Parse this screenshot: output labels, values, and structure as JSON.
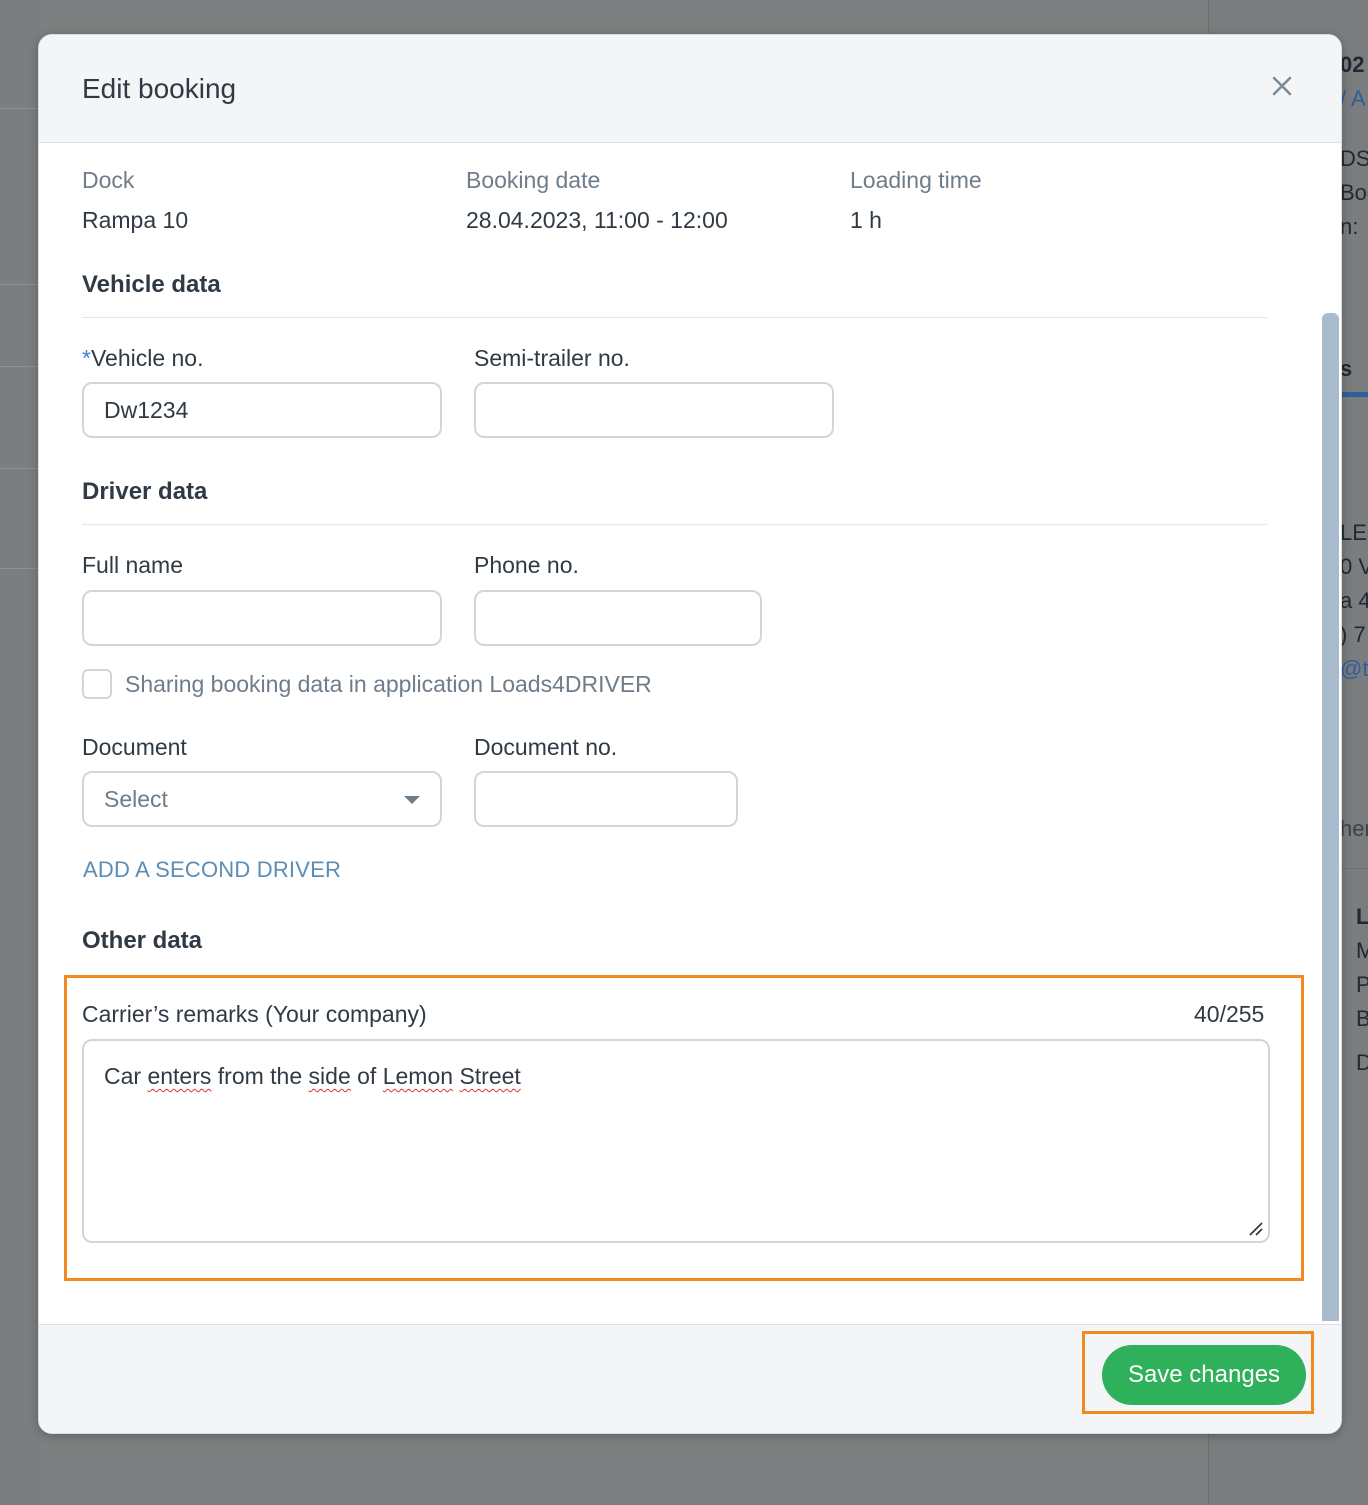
{
  "modal": {
    "title": "Edit booking",
    "close_icon": "close-icon"
  },
  "summary": {
    "dock_label": "Dock",
    "dock_value": "Rampa 10",
    "date_label": "Booking date",
    "date_value": "28.04.2023, 11:00 - 12:00",
    "time_label": "Loading time",
    "time_value": "1 h"
  },
  "vehicle": {
    "section_title": "Vehicle data",
    "required_mark": "*",
    "vehicle_no_label": "Vehicle no.",
    "vehicle_no_value": "Dw1234",
    "trailer_label": "Semi-trailer no.",
    "trailer_value": ""
  },
  "driver": {
    "section_title": "Driver data",
    "full_name_label": "Full name",
    "full_name_value": "",
    "phone_label": "Phone no.",
    "phone_value": "",
    "share_label": "Sharing booking data in application Loads4DRIVER",
    "share_checked": false,
    "document_label": "Document",
    "document_placeholder": "Select",
    "document_no_label": "Document no.",
    "document_no_value": "",
    "add_driver_label": "ADD A SECOND DRIVER"
  },
  "other": {
    "section_title": "Other data",
    "remarks_label": "Carrier’s remarks (Your company)",
    "remarks_counter": "40/255",
    "remarks_words": [
      "Car ",
      "enters",
      " from the ",
      "side",
      " of ",
      "Lemon",
      " ",
      "Street"
    ]
  },
  "footer": {
    "save_label": "Save changes"
  },
  "background": {
    "fragments": [
      "02",
      "/ A",
      "DS",
      "Boo",
      "n:",
      "s",
      "LE",
      "0 V",
      "a 4",
      ") 7",
      "@t",
      "her",
      "L",
      "M",
      "P",
      "B",
      "D"
    ]
  },
  "colors": {
    "accent_green": "#2fb05a",
    "highlight_orange": "#f08a1c",
    "link_blue": "#5b8db5",
    "required_blue": "#3b82d6"
  }
}
